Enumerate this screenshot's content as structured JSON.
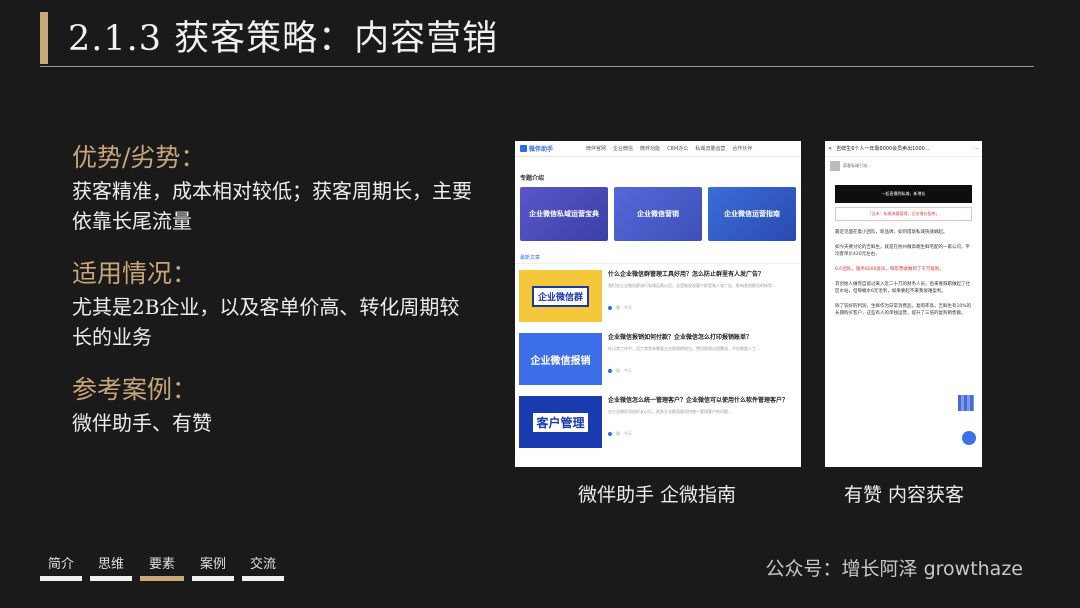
{
  "title": "2.1.3 获客策略：内容营销",
  "sections": [
    {
      "heading": "优势/劣势：",
      "body": "获客精准，成本相对较低；获客周期长，主要依靠长尾流量"
    },
    {
      "heading": "适用情况：",
      "body": "尤其是2B企业，以及客单价高、转化周期较长的业务"
    },
    {
      "heading": "参考案例：",
      "body": "微伴助手、有赞"
    }
  ],
  "shot1": {
    "logo": "微伴助手",
    "nav": [
      "微伴官网",
      "企业微信",
      "微伴功能",
      "CRM办公",
      "私域流量运营",
      "合作伙伴"
    ],
    "section_label": "专题介绍",
    "cards": [
      "企业微信私域运营宝典",
      "企业微信营销",
      "企业微信运营指南"
    ],
    "latest_label": "最新文章",
    "articles": [
      {
        "thumb": "企业微信群",
        "title": "什么企业微信群管理工具好用？怎么防止群里有人发广告？",
        "desc": "我们在企业微信群进行私域运营以后，总是能发现客户群里有人发广告，影响其他群员的体验...",
        "author": "慢",
        "date": "今天"
      },
      {
        "thumb": "企业微信报销",
        "title": "企业微信报销如何付款？企业微信怎么打印报销账单？",
        "desc": "在日常工作中，员工常常有需要企业报销的地方。费用报销过程繁琐，不仅需要人工...",
        "author": "慢",
        "date": "今天"
      },
      {
        "thumb": "客户管理",
        "title": "企业微信怎么统一管理客户？企业微信可以使用什么软件管理客户？",
        "desc": "在企业微信添加好友以后，很多企业都面临如何统一管理客户的问题...",
        "author": "慢",
        "date": "今天"
      }
    ]
  },
  "shot2": {
    "top_title": "吉鲜生6个人一年靠6000会员卖出1000...",
    "author_text": "获客私域引流...",
    "banner": "一起直播到私域，新增长",
    "quote": "「丑末：私域流量管理，企业增长智库」",
    "paragraphs": [
      "最近见面在着小团队，新品牌，如何借助私域快速崛起。",
      "如今天要讨论的吉鲜生，就是在杭州做高端生鲜宅配的一家公司，平均客单价420元左右，",
      "6人团队，服务6000会员，每年营收做到了千万级别。",
      "其创始人做完自留过来入近二十万的财务人员，后来要辞职做起了社区水站，但每桶水6元毛利，如果要起不来我很难盈利。",
      "除了较好的利润，生鲜作为日常消费品，复购率高，吉鲜生有10%的长期购买客户，这些有人的单独运营，提升了三倍的复购销售额。"
    ]
  },
  "captions": [
    "微伴助手  企微指南",
    "有赞  内容获客"
  ],
  "footer_nav": [
    {
      "label": "简介",
      "active": false
    },
    {
      "label": "思维",
      "active": false
    },
    {
      "label": "要素",
      "active": true
    },
    {
      "label": "案例",
      "active": false
    },
    {
      "label": "交流",
      "active": false
    }
  ],
  "brand": "公众号：增长阿泽  growthaze",
  "colors": {
    "accent": "#c8a97a",
    "background": "#1a1a1a"
  }
}
